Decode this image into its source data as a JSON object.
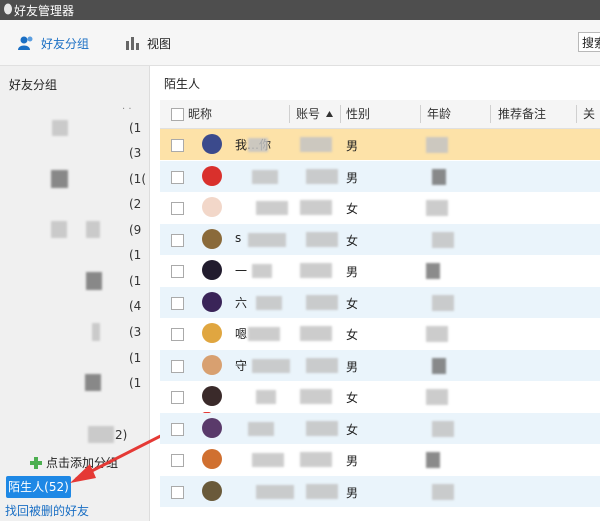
{
  "window": {
    "title": "好友管理器"
  },
  "toolbar": {
    "groups_label": "好友分组",
    "view_label": "视图",
    "search_label": "搜索"
  },
  "sidebar": {
    "header": "好友分组",
    "groups": [
      {
        "count": "(1"
      },
      {
        "count": "(3"
      },
      {
        "count": "(1("
      },
      {
        "count": "(2"
      },
      {
        "count": "(9"
      },
      {
        "count": "(1"
      },
      {
        "count": "(1"
      },
      {
        "count": "(4"
      },
      {
        "count": "(3"
      },
      {
        "count": "(1"
      },
      {
        "count": "(1"
      },
      {
        "count": "2)"
      }
    ],
    "add_group_label": "点击添加分组",
    "stranger_button": "陌生人(52)",
    "recover_link": "找回被删的好友"
  },
  "panel": {
    "title": "陌生人",
    "columns": [
      "昵称",
      "账号",
      "性别",
      "年龄",
      "推荐备注",
      "关注"
    ],
    "rows": [
      {
        "nickname": "我…你",
        "gender": "男",
        "avatar_color": "#3b4a8c",
        "highlighted": true
      },
      {
        "nickname": "",
        "gender": "男",
        "avatar_color": "#d9302c",
        "highlighted": false
      },
      {
        "nickname": "",
        "gender": "女",
        "avatar_color": "#f2d7c9",
        "highlighted": false
      },
      {
        "nickname": "s",
        "gender": "女",
        "avatar_color": "#8a6a3a",
        "highlighted": false
      },
      {
        "nickname": "一",
        "gender": "男",
        "avatar_color": "#221c2e",
        "highlighted": false
      },
      {
        "nickname": "六",
        "gender": "女",
        "avatar_color": "#3a2458",
        "highlighted": false
      },
      {
        "nickname": "嗯",
        "gender": "女",
        "avatar_color": "#e0a640",
        "highlighted": false
      },
      {
        "nickname": "守",
        "gender": "男",
        "avatar_color": "#d8a070",
        "highlighted": false
      },
      {
        "nickname": "",
        "gender": "女",
        "avatar_color": "#3a2a2a",
        "highlighted": false
      },
      {
        "nickname": "",
        "gender": "女",
        "avatar_color": "#5a3a6a",
        "highlighted": false
      },
      {
        "nickname": "",
        "gender": "男",
        "avatar_color": "#d07030",
        "highlighted": false
      },
      {
        "nickname": "",
        "gender": "男",
        "avatar_color": "#6a5a3a",
        "highlighted": false
      }
    ]
  },
  "colors": {
    "accent": "#1e88e5",
    "row_highlight": "#fde2a8",
    "row_alt": "#eaf4fb",
    "annotation_arrow": "#e53935"
  }
}
